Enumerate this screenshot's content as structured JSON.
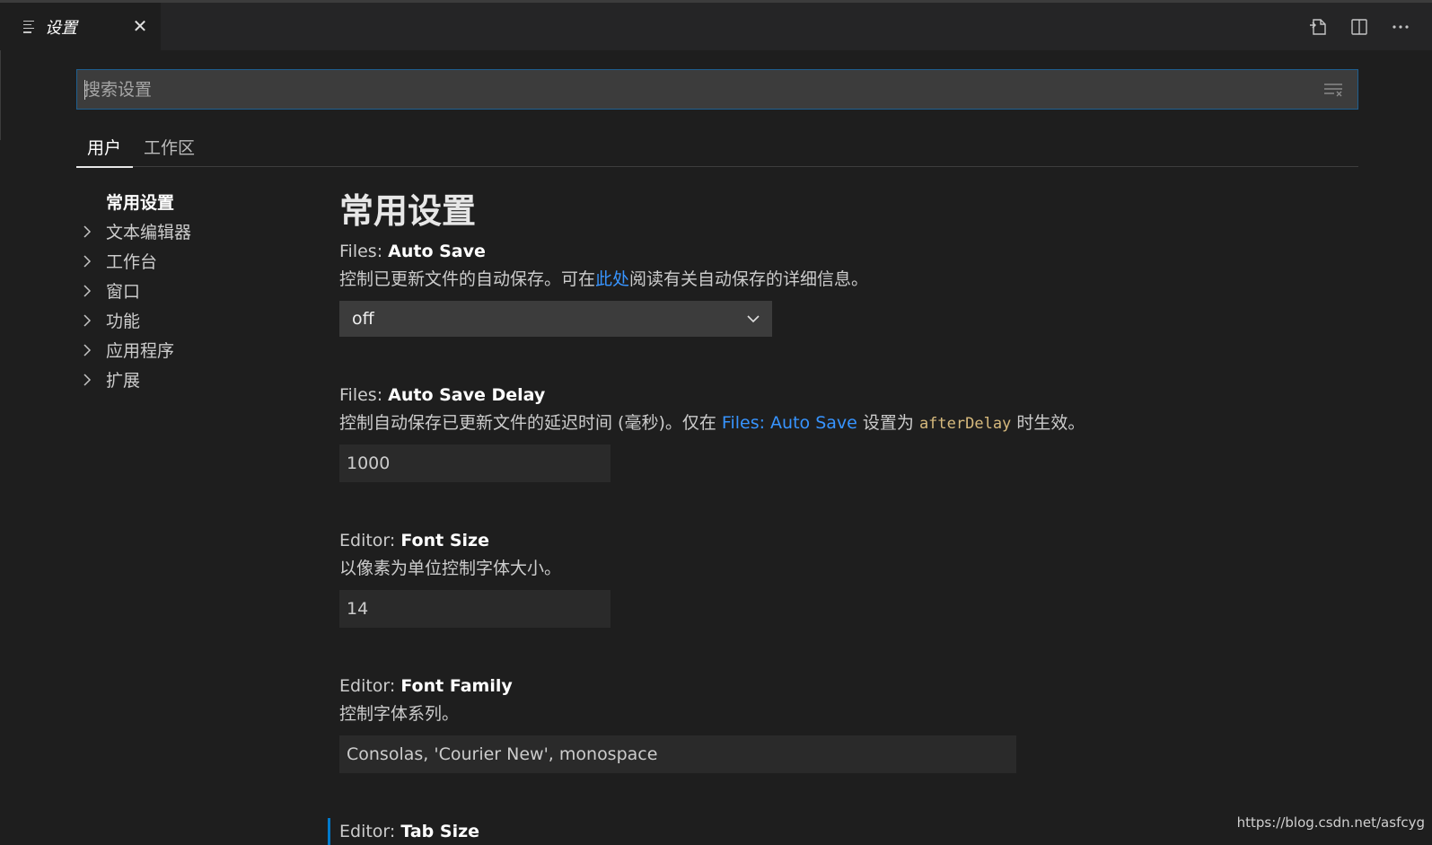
{
  "editor_tab": {
    "title": "设置",
    "close_symbol": "✕"
  },
  "header_actions": [
    "open-settings-json-icon",
    "split-editor-icon",
    "more-actions-icon"
  ],
  "search": {
    "placeholder": "搜索设置",
    "value": ""
  },
  "scope_tabs": [
    "用户",
    "工作区"
  ],
  "toc": {
    "heading": "常用设置",
    "items": [
      "文本编辑器",
      "工作台",
      "窗口",
      "功能",
      "应用程序",
      "扩展"
    ]
  },
  "main": {
    "section_title": "常用设置",
    "settings": [
      {
        "category": "Files: ",
        "name": "Auto Save",
        "desc_before": "控制已更新文件的自动保存。可在",
        "desc_link": "此处",
        "desc_after": "阅读有关自动保存的详细信息。",
        "control": "select",
        "value": "off"
      },
      {
        "category": "Files: ",
        "name": "Auto Save Delay",
        "desc_before": "控制自动保存已更新文件的延迟时间 (毫秒)。仅在 ",
        "desc_link": "Files: Auto Save",
        "desc_mid": " 设置为 ",
        "desc_code": "afterDelay",
        "desc_after": " 时生效。",
        "control": "number",
        "value": "1000"
      },
      {
        "category": "Editor: ",
        "name": "Font Size",
        "desc": "以像素为单位控制字体大小。",
        "control": "number",
        "value": "14"
      },
      {
        "category": "Editor: ",
        "name": "Font Family",
        "desc": "控制字体系列。",
        "control": "text",
        "value": "Consolas, 'Courier New', monospace"
      },
      {
        "category": "Editor: ",
        "name": "Tab Size"
      }
    ]
  },
  "watermark": "https://blog.csdn.net/asfcyg",
  "colors": {
    "background": "#1e1e1e",
    "link": "#3794ff",
    "input": "#3c3c3c",
    "accent": "#007acc",
    "code": "#d7ba7d"
  }
}
